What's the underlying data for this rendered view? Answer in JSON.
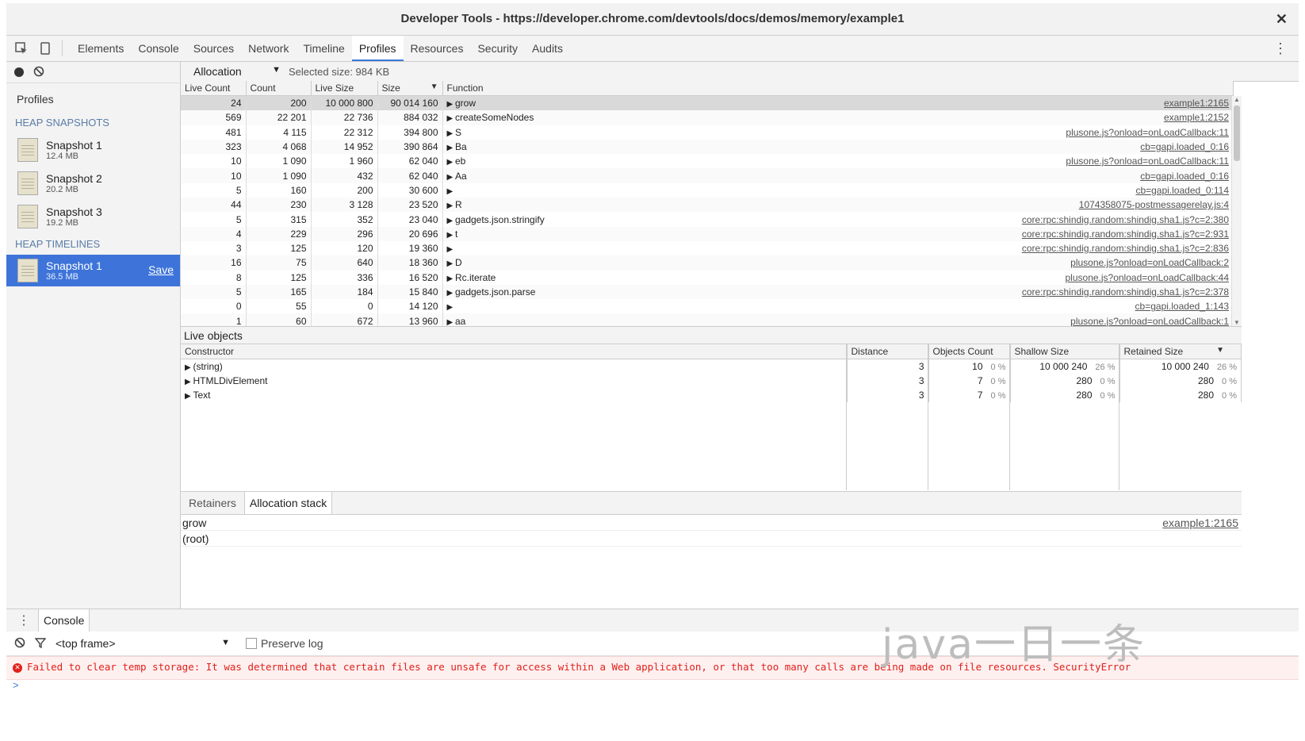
{
  "window": {
    "title": "Developer Tools - https://developer.chrome.com/devtools/docs/demos/memory/example1"
  },
  "toolbar": {
    "tabs": [
      "Elements",
      "Console",
      "Sources",
      "Network",
      "Timeline",
      "Profiles",
      "Resources",
      "Security",
      "Audits"
    ],
    "active_tab": "Profiles"
  },
  "sidebar": {
    "title": "Profiles",
    "heap_snapshots_heading": "HEAP SNAPSHOTS",
    "snapshots": [
      {
        "name": "Snapshot 1",
        "size": "12.4 MB"
      },
      {
        "name": "Snapshot 2",
        "size": "20.2 MB"
      },
      {
        "name": "Snapshot 3",
        "size": "19.2 MB"
      }
    ],
    "heap_timelines_heading": "HEAP TIMELINES",
    "timeline": {
      "name": "Snapshot 1",
      "size": "36.5 MB",
      "save": "Save"
    }
  },
  "alloc": {
    "view": "Allocation",
    "selected_size": "Selected size: 984 KB",
    "columns": [
      "Live Count",
      "Count",
      "Live Size",
      "Size",
      "Function"
    ],
    "rows": [
      [
        "24",
        "200",
        "10 000 800",
        "90 014 160",
        "grow",
        "example1:2165"
      ],
      [
        "569",
        "22 201",
        "22 736",
        "884 032",
        "createSomeNodes",
        "example1:2152"
      ],
      [
        "481",
        "4 115",
        "22 312",
        "394 800",
        "S",
        "plusone.js?onload=onLoadCallback:11"
      ],
      [
        "323",
        "4 068",
        "14 952",
        "390 864",
        "Ba",
        "cb=gapi.loaded_0:16"
      ],
      [
        "10",
        "1 090",
        "1 960",
        "62 040",
        "eb",
        "plusone.js?onload=onLoadCallback:11"
      ],
      [
        "10",
        "1 090",
        "432",
        "62 040",
        "Aa",
        "cb=gapi.loaded_0:16"
      ],
      [
        "5",
        "160",
        "200",
        "30 600",
        "",
        "cb=gapi.loaded_0:114"
      ],
      [
        "44",
        "230",
        "3 128",
        "23 520",
        "R",
        "1074358075-postmessagerelay.js:4"
      ],
      [
        "5",
        "315",
        "352",
        "23 040",
        "gadgets.json.stringify",
        "core:rpc:shindig.random:shindig.sha1.js?c=2:380"
      ],
      [
        "4",
        "229",
        "296",
        "20 696",
        "t",
        "core:rpc:shindig.random:shindig.sha1.js?c=2:931"
      ],
      [
        "3",
        "125",
        "120",
        "19 360",
        "",
        "core:rpc:shindig.random:shindig.sha1.js?c=2:836"
      ],
      [
        "16",
        "75",
        "640",
        "18 360",
        "D",
        "plusone.js?onload=onLoadCallback:2"
      ],
      [
        "8",
        "125",
        "336",
        "16 520",
        "Rc.iterate",
        "plusone.js?onload=onLoadCallback:44"
      ],
      [
        "5",
        "165",
        "184",
        "15 840",
        "gadgets.json.parse",
        "core:rpc:shindig.random:shindig.sha1.js?c=2:378"
      ],
      [
        "0",
        "55",
        "0",
        "14 120",
        "",
        "cb=gapi.loaded_1:143"
      ],
      [
        "1",
        "60",
        "672",
        "13 960",
        "aa",
        "plusone.js?onload=onLoadCallback:1"
      ]
    ]
  },
  "live": {
    "title": "Live objects",
    "columns": [
      "Constructor",
      "Distance",
      "Objects Count",
      "Shallow Size",
      "Retained Size"
    ],
    "rows": [
      {
        "name": "(string)",
        "distance": "3",
        "count": "10",
        "count_pct": "0 %",
        "shallow": "10 000 240",
        "shallow_pct": "26 %",
        "retained": "10 000 240",
        "retained_pct": "26 %"
      },
      {
        "name": "HTMLDivElement",
        "distance": "3",
        "count": "7",
        "count_pct": "0 %",
        "shallow": "280",
        "shallow_pct": "0 %",
        "retained": "280",
        "retained_pct": "0 %"
      },
      {
        "name": "Text",
        "distance": "3",
        "count": "7",
        "count_pct": "0 %",
        "shallow": "280",
        "shallow_pct": "0 %",
        "retained": "280",
        "retained_pct": "0 %"
      }
    ]
  },
  "bottom": {
    "tabs": [
      "Retainers",
      "Allocation stack"
    ],
    "active_tab": "Allocation stack",
    "stack": [
      {
        "fn": "grow",
        "link": "example1:2165"
      },
      {
        "fn": "(root)",
        "link": ""
      }
    ]
  },
  "console": {
    "tab": "Console",
    "frame": "<top frame>",
    "preserve_log": "Preserve log",
    "error": "Failed to clear temp storage: It was determined that certain files are unsafe for access within a Web application, or that too many calls are being made on file resources. SecurityError",
    "prompt": ">"
  },
  "watermark": "java一日一条",
  "colors": {
    "accent": "#3e74d9",
    "error": "#e0211a",
    "link": "#555555"
  }
}
